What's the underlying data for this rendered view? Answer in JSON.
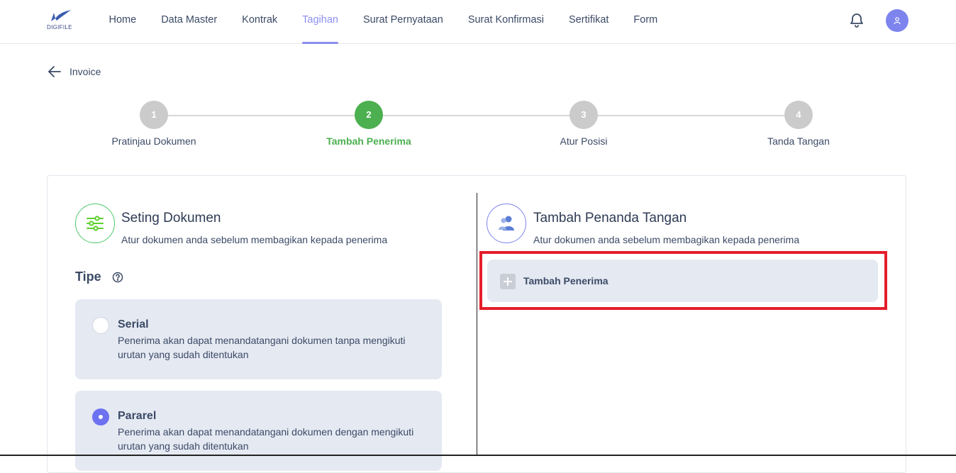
{
  "brand": {
    "logo_text": "DIGIFILE",
    "accent": "#8b8ff0",
    "success": "#4caf50"
  },
  "nav": {
    "items": [
      {
        "label": "Home",
        "active": false
      },
      {
        "label": "Data Master",
        "active": false
      },
      {
        "label": "Kontrak",
        "active": false
      },
      {
        "label": "Tagihan",
        "active": true
      },
      {
        "label": "Surat Pernyataan",
        "active": false
      },
      {
        "label": "Surat Konfirmasi",
        "active": false
      },
      {
        "label": "Sertifikat",
        "active": false
      },
      {
        "label": "Form",
        "active": false
      }
    ],
    "bell_icon": "bell-icon",
    "avatar_icon": "user-icon"
  },
  "back": {
    "label": "Invoice",
    "icon": "arrow-left-icon"
  },
  "stepper": {
    "steps": [
      {
        "number": "1",
        "label": "Pratinjau Dokumen",
        "active": false
      },
      {
        "number": "2",
        "label": "Tambah Penerima",
        "active": true
      },
      {
        "number": "3",
        "label": "Atur Posisi",
        "active": false
      },
      {
        "number": "4",
        "label": "Tanda Tangan",
        "active": false
      }
    ]
  },
  "left": {
    "icon": "sliders-icon",
    "title": "Seting Dokumen",
    "subtitle": "Atur dokumen anda sebelum membagikan kepada penerima",
    "tipe_label": "Tipe",
    "options": [
      {
        "title": "Serial",
        "desc": "Penerima akan dapat menandatangani dokumen tanpa mengikuti urutan yang sudah ditentukan",
        "checked": false
      },
      {
        "title": "Pararel",
        "desc": "Penerima akan dapat menandatangani dokumen dengan mengikuti urutan yang sudah ditentukan",
        "checked": true
      }
    ]
  },
  "right": {
    "icon": "users-icon",
    "title": "Tambah Penanda Tangan",
    "subtitle": "Atur dokumen anda sebelum membagikan kepada penerima",
    "add_button": "Tambah Penerima"
  }
}
